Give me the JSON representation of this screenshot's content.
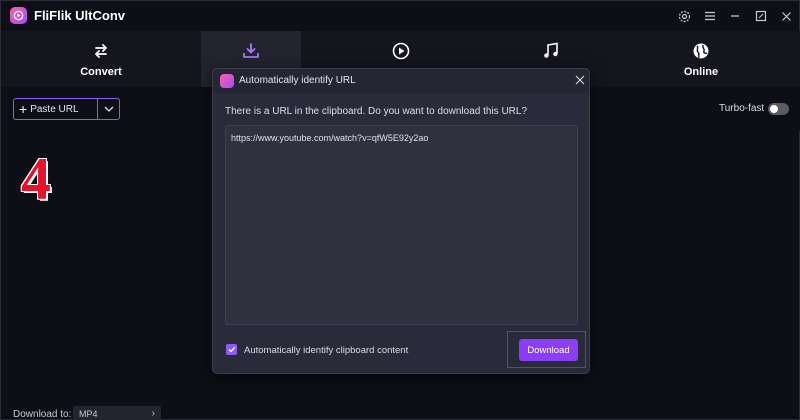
{
  "app": {
    "title": "FliFlik UltConv"
  },
  "nav": {
    "items": [
      {
        "label": "Convert",
        "icon": "swap-arrows-icon"
      },
      {
        "label": "",
        "icon": "download-tray-icon"
      },
      {
        "label": "",
        "icon": "play-circle-icon"
      },
      {
        "label": "",
        "icon": "music-note-icon"
      },
      {
        "label": "Online",
        "icon": "globe-icon"
      }
    ]
  },
  "toolbar": {
    "paste_label": "Paste URL",
    "turbo_label": "Turbo-fast",
    "turbo_on": false
  },
  "overlay": {
    "step_number": "4"
  },
  "footer": {
    "download_to_label": "Download to:",
    "format_value": "MP4"
  },
  "dialog": {
    "title": "Automatically identify URL",
    "question": "There is a URL in the clipboard. Do you want to download this URL?",
    "url": "https://www.youtube.com/watch?v=qfW5E92y2ao",
    "checkbox_label": "Automatically identify clipboard content",
    "checkbox_checked": true,
    "download_label": "Download"
  },
  "colors": {
    "accent": "#8b5cf6",
    "highlight": "#e4122b"
  }
}
